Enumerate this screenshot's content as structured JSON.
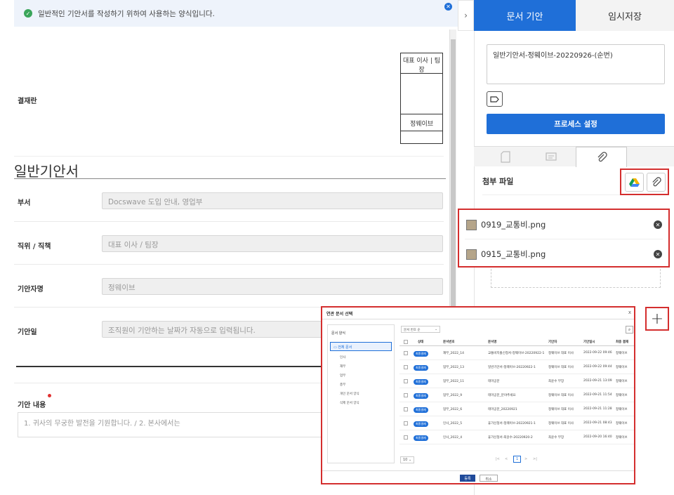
{
  "notice": {
    "text": "일반적인 기안서를 작성하기 위하여 사용하는 양식입니다."
  },
  "approval": {
    "label": "결재란",
    "role": "대표 이사 | 팀장",
    "approver": "정웨이브"
  },
  "form": {
    "title": "일반기안서",
    "rows": [
      {
        "label": "부서",
        "value": "Docswave 도입 안내, 영업부"
      },
      {
        "label": "직위 / 직책",
        "value": "대표 이사 / 팀장"
      },
      {
        "label": "기안자명",
        "value": "정웨이브"
      },
      {
        "label": "기안일",
        "value": "조직원이 기안하는 날짜가 자동으로 입력됩니다."
      }
    ],
    "content_label": "기안 내용",
    "content_placeholder": "1. 귀사의 무궁한 발전을 기원합니다. / 2. 본사에서는"
  },
  "panel": {
    "tab_title": "문서 기안",
    "tab_draft": "임시저장",
    "doc_name": "일반기안서-정웨이브-20220926-(순번)",
    "process_button": "프로세스 설정",
    "attach_title": "첨부 파일",
    "files": [
      "0919_교통비.png",
      "0915_교통비.png"
    ]
  },
  "modal": {
    "title": "연관 문서 선택",
    "close": "x",
    "sidebar_title": "문서 양식",
    "selected_folder": "전체 문서",
    "folders": [
      "인사",
      "재무",
      "업무",
      "총무",
      "개인 문서 양식",
      "삭제 문서 양식"
    ],
    "sort_label": "문서 번호 순",
    "columns": [
      "상태",
      "문서번호",
      "문서명",
      "기안자",
      "기안일시",
      "최종 결재"
    ],
    "rows": [
      {
        "status": "최종결재",
        "no": "재무_2022_14",
        "name": "교통비지출신청서-정웨이브-20220922-1",
        "drafter": "정웨이브 대표 이사",
        "date": "2022-09-22 09:46",
        "final": "정웨이브"
      },
      {
        "status": "최종결재",
        "no": "업무_2022_13",
        "name": "일반기안서-정웨이브-20220922-1",
        "drafter": "정웨이브 대표 이사",
        "date": "2022-09-22 09:44",
        "final": "정웨이브"
      },
      {
        "status": "최종결재",
        "no": "업무_2022_11",
        "name": "테마공문",
        "drafter": "최윤수 부장",
        "date": "2022-09-21 13:09",
        "final": "정웨이브"
      },
      {
        "status": "최종결재",
        "no": "업무_2022_9",
        "name": "테마공문_분야추세요",
        "drafter": "정웨이브 대표 이사",
        "date": "2022-09-21 11:54",
        "final": "정웨이브"
      },
      {
        "status": "최종결재",
        "no": "업무_2022_6",
        "name": "테마공문_20220921",
        "drafter": "정웨이브 대표 이사",
        "date": "2022-09-21 11:28",
        "final": "정웨이브"
      },
      {
        "status": "최종결재",
        "no": "인사_2022_5",
        "name": "휴가신청서-정웨이브-20220921-1",
        "drafter": "정웨이브 대표 이사",
        "date": "2022-09-21 08:43",
        "final": "정웨이브"
      },
      {
        "status": "최종결재",
        "no": "인사_2022_4",
        "name": "휴가신청서-최윤수-20220920-2",
        "drafter": "최윤수 부장",
        "date": "2022-09-20 16:40",
        "final": "정웨이브"
      }
    ],
    "page_size": "10",
    "page": "1",
    "ok_label": "등록",
    "cancel_label": "취소"
  }
}
